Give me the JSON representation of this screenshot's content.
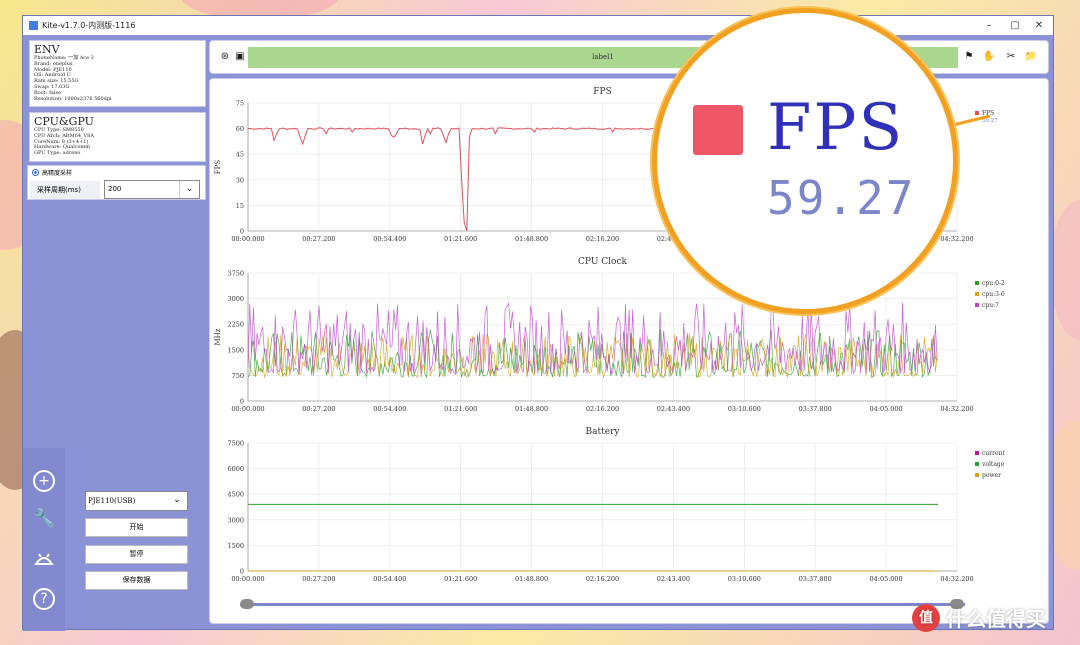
{
  "window": {
    "title": "Kite-v1.7.0-内测版-1116"
  },
  "env": {
    "title": "ENV",
    "lines": [
      "PhoneName: 一加 Ace 3",
      "Brand: oneplus",
      "Model: PJE110",
      "OS: Android U",
      "Ram size: 15.55G",
      "Swap: 17.03G",
      "Root: false",
      "Resolution: 1080x2376 560dpi"
    ]
  },
  "cpu": {
    "title": "CPU&GPU",
    "lines": [
      "CPU Type: SM8550",
      "CPU Arch: ARM64_V8A",
      "CoreNum: 8 (3+4+1)",
      "Hardware: Qualcomm",
      "GPU Type: adreno"
    ]
  },
  "sampling": {
    "radio_label": "高精度采样",
    "period_label": "采样周期(ms)",
    "period_value": "200"
  },
  "controls": {
    "device": "PJE110(USB)",
    "start": "开始",
    "pause": "暂停",
    "save": "保存数据"
  },
  "sidebar": {
    "icons": [
      "add-circle-icon",
      "wrench-icon",
      "android-icon",
      "help-icon"
    ]
  },
  "toolbar": {
    "label": "label1",
    "icons": [
      "target-icon",
      "image-icon",
      "bookmark-icon",
      "hand-icon",
      "scissors-icon",
      "folder-icon"
    ]
  },
  "magnifier": {
    "label": "FPS",
    "value": "59.27"
  },
  "watermark": {
    "text": "什么值得买",
    "icon": "值"
  },
  "colors": {
    "fps": "#e0505c",
    "cpu02": "#2ca02c",
    "cpu36": "#d4a017",
    "cpu7": "#c043d0",
    "current": "#c0188f",
    "voltage": "#2ca02c",
    "power": "#d4a017",
    "accent": "#8b93d6"
  },
  "chart_data": [
    {
      "type": "line",
      "title": "FPS",
      "ylabel": "FPS",
      "ylim": [
        0,
        75
      ],
      "yticks": [
        0,
        15,
        30,
        45,
        60,
        75
      ],
      "xticks": [
        "00:00.000",
        "00:27.200",
        "00:54.400",
        "01:21.600",
        "01:48.800",
        "02:16.200",
        "02:43.400",
        "03:10.600",
        "03:37.800",
        "04:05.000",
        "04:32.200"
      ],
      "xlim": [
        0,
        272.2
      ],
      "series": [
        {
          "name": "FPS",
          "value": "59.27",
          "dips": [
            [
              10,
              53
            ],
            [
              11,
              57
            ],
            [
              20,
              55
            ],
            [
              21,
              51
            ],
            [
              22,
              56
            ],
            [
              30,
              57
            ],
            [
              40,
              58
            ],
            [
              55,
              56
            ],
            [
              56,
              55
            ],
            [
              57,
              57
            ],
            [
              67,
              51
            ],
            [
              68,
              56
            ],
            [
              70,
              57
            ],
            [
              75,
              56
            ],
            [
              76,
              52
            ],
            [
              77,
              57
            ],
            [
              82,
              30
            ],
            [
              83,
              5
            ],
            [
              84,
              0
            ],
            [
              85,
              55
            ],
            [
              95,
              57
            ],
            [
              110,
              58
            ],
            [
              140,
              58
            ],
            [
              170,
              57
            ],
            [
              200,
              57
            ],
            [
              230,
              57
            ],
            [
              260,
              56
            ]
          ]
        }
      ]
    },
    {
      "type": "line",
      "title": "CPU Clock",
      "ylabel": "MHz",
      "ylim": [
        0,
        3750
      ],
      "yticks": [
        0,
        750,
        1500,
        2250,
        3000,
        3750
      ],
      "xticks": [
        "00:00.000",
        "00:27.200",
        "00:54.400",
        "01:21.600",
        "01:48.800",
        "02:16.200",
        "02:43.400",
        "03:10.600",
        "03:37.800",
        "04:05.000",
        "04:32.200"
      ],
      "xlim": [
        0,
        272.2
      ],
      "series": [
        {
          "name": "cpu:0-2",
          "min": 700,
          "max": 2100
        },
        {
          "name": "cpu:3-6",
          "min": 700,
          "max": 2000
        },
        {
          "name": "cpu:7",
          "min": 800,
          "max": 2900
        }
      ]
    },
    {
      "type": "line",
      "title": "Battery",
      "ylim": [
        0,
        7500
      ],
      "yticks": [
        0,
        1500,
        3000,
        4500,
        6000,
        7500
      ],
      "xticks": [
        "00:00.000",
        "00:27.200",
        "00:54.400",
        "01:21.600",
        "01:48.800",
        "02:16.200",
        "02:43.400",
        "03:10.600",
        "03:37.800",
        "04:05.000",
        "04:32.200"
      ],
      "xlim": [
        0,
        272.2
      ],
      "series": [
        {
          "name": "current",
          "constant": 0
        },
        {
          "name": "voltage",
          "constant": 3900
        },
        {
          "name": "power",
          "constant": 0
        }
      ]
    }
  ]
}
